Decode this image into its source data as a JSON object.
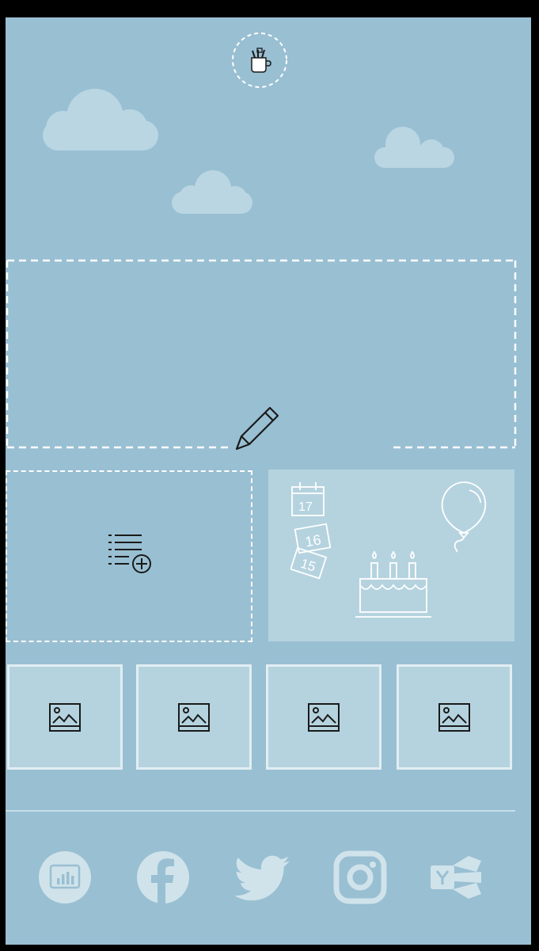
{
  "header": {
    "logo_icon": "mug-with-pencils-icon"
  },
  "banner": {
    "edit_icon": "pencil-icon"
  },
  "tiles": {
    "add_list_icon": "list-add-icon",
    "birthday": {
      "calendar_days": [
        "17",
        "16",
        "15"
      ],
      "icons": [
        "calendar-icon",
        "balloon-icon",
        "birthday-cake-icon"
      ]
    }
  },
  "gallery": {
    "photos": [
      "image-placeholder-icon",
      "image-placeholder-icon",
      "image-placeholder-icon",
      "image-placeholder-icon"
    ]
  },
  "social": [
    "analytics-icon",
    "facebook-icon",
    "twitter-icon",
    "instagram-icon",
    "yammer-icon"
  ],
  "colors": {
    "background": "#99bfd2",
    "tile": "#b5d3df",
    "cloud": "#b9d6e2",
    "icon_light": "#d0e3eb"
  }
}
